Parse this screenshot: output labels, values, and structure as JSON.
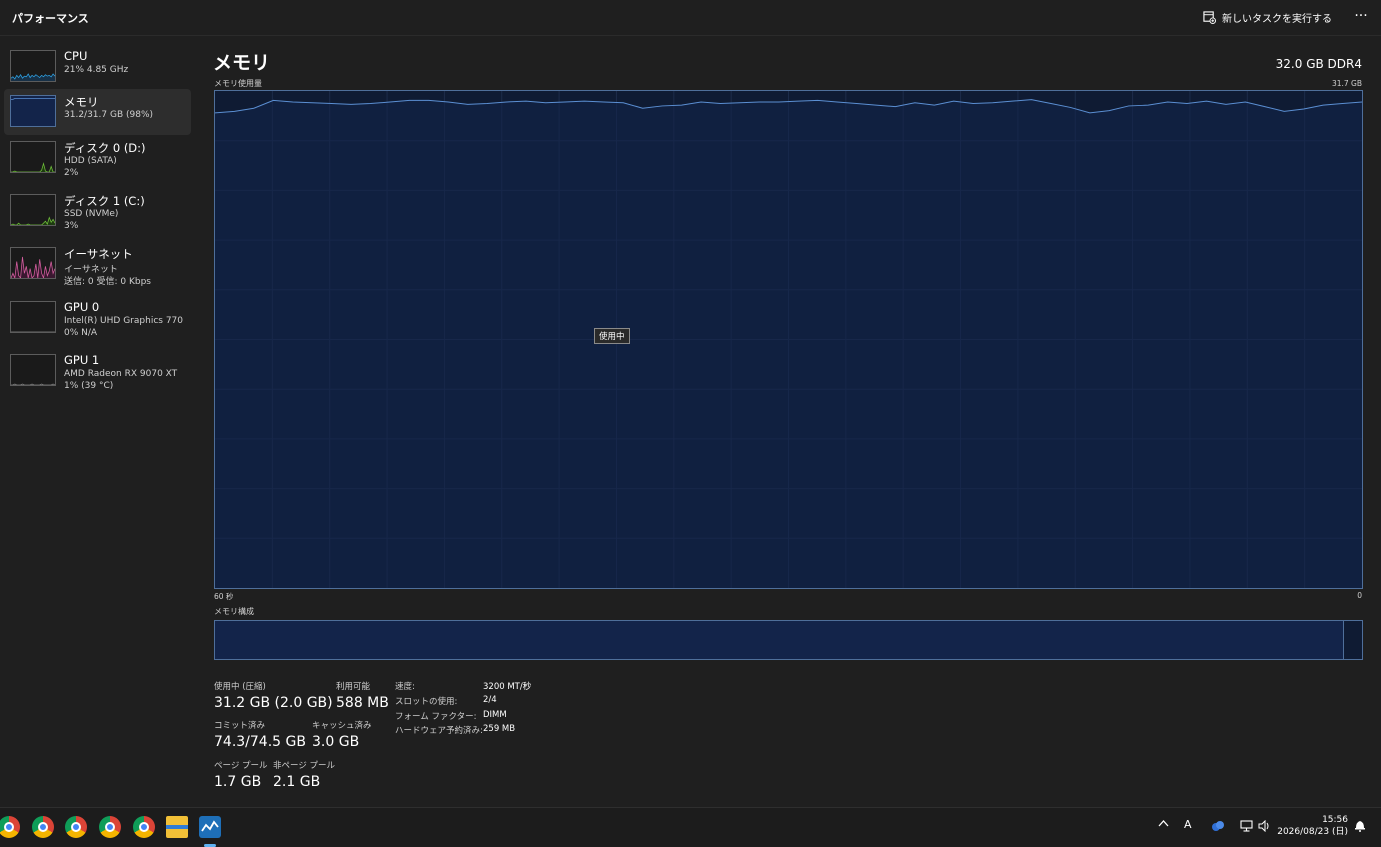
{
  "window": {
    "title": "パフォーマンス",
    "run_task_label": "新しいタスクを実行する",
    "more_label": "···"
  },
  "sidebar": {
    "items": [
      {
        "name": "CPU",
        "sub1": "21% 4.85 GHz",
        "sub2": ""
      },
      {
        "name": "メモリ",
        "sub1": "31.2/31.7 GB (98%)",
        "sub2": ""
      },
      {
        "name": "ディスク 0 (D:)",
        "sub1": "HDD (SATA)",
        "sub2": "2%"
      },
      {
        "name": "ディスク 1 (C:)",
        "sub1": "SSD (NVMe)",
        "sub2": "3%"
      },
      {
        "name": "イーサネット",
        "sub1": "イーサネット",
        "sub2": "送信: 0 受信: 0 Kbps"
      },
      {
        "name": "GPU 0",
        "sub1": "Intel(R) UHD Graphics 770",
        "sub2": "0% N/A"
      },
      {
        "name": "GPU 1",
        "sub1": "AMD Radeon RX 9070 XT",
        "sub2": "1% (39 °C)"
      }
    ]
  },
  "main": {
    "title": "メモリ",
    "spec": "32.0 GB DDR4",
    "graph_label": "メモリ使用量",
    "graph_max": "31.7 GB",
    "tooltip": "使用中",
    "axis_left": "60 秒",
    "axis_right": "0",
    "composition_label": "メモリ構成",
    "composition_used_fraction": 0.984
  },
  "stats": {
    "in_use_label": "使用中 (圧縮)",
    "in_use_value": "31.2 GB (2.0 GB)",
    "available_label": "利用可能",
    "available_value": "588 MB",
    "committed_label": "コミット済み",
    "committed_value": "74.3/74.5 GB",
    "cached_label": "キャッシュ済み",
    "cached_value": "3.0 GB",
    "paged_label": "ページ プール",
    "paged_value": "1.7 GB",
    "nonpaged_label": "非ページ プール",
    "nonpaged_value": "2.1 GB"
  },
  "details": {
    "speed_label": "速度:",
    "speed_value": "3200 MT/秒",
    "slots_label": "スロットの使用:",
    "slots_value": "2/4",
    "form_label": "フォーム ファクター:",
    "form_value": "DIMM",
    "hw_reserved_label": "ハードウェア予約済み:",
    "hw_reserved_value": "259 MB"
  },
  "chart_data": {
    "type": "area",
    "x_range_seconds": [
      60,
      0
    ],
    "ylim_gb": [
      0,
      31.7
    ],
    "series": [
      {
        "values_gb": [
          30.3,
          30.4,
          30.6,
          31.1,
          31.0,
          30.95,
          30.9,
          30.85,
          30.9,
          31.0,
          31.1,
          31.1,
          31.0,
          30.85,
          30.9,
          31.0,
          31.05,
          30.95,
          31.0,
          31.05,
          31.0,
          30.95,
          30.6,
          30.75,
          30.8,
          31.0,
          30.9,
          30.95,
          31.0,
          31.0,
          31.05,
          31.1,
          31.0,
          30.9,
          30.8,
          30.7,
          30.95,
          30.8,
          31.05,
          30.9,
          30.95,
          31.05,
          31.15,
          30.9,
          30.65,
          30.3,
          30.45,
          30.75,
          30.8,
          31.0,
          30.9,
          31.05,
          30.85,
          31.0,
          30.7,
          30.4,
          30.55,
          30.8,
          30.9,
          31.0
        ]
      }
    ],
    "grid": true
  },
  "thumbnails": {
    "cpu": [
      4,
      6,
      3,
      8,
      5,
      9,
      4,
      7,
      6,
      10,
      5,
      8,
      6,
      9,
      7,
      5,
      8,
      6,
      9,
      7,
      8,
      6,
      10,
      7
    ],
    "memory": [
      30,
      30,
      31,
      31,
      31,
      31,
      31,
      31,
      31,
      31,
      31,
      31,
      31,
      31,
      31,
      31,
      31,
      31,
      31,
      31,
      31,
      31,
      31,
      31
    ],
    "disk0": [
      0,
      0,
      1,
      0,
      0,
      0,
      0,
      0,
      0,
      0,
      0,
      0,
      0,
      0,
      0,
      0,
      2,
      9,
      1,
      0,
      0,
      6,
      0,
      0
    ],
    "disk1": [
      0,
      1,
      0,
      0,
      2,
      0,
      0,
      0,
      0,
      1,
      0,
      0,
      0,
      0,
      0,
      0,
      0,
      2,
      4,
      1,
      8,
      3,
      6,
      2
    ],
    "ethernet": [
      0,
      2,
      0,
      7,
      1,
      0,
      9,
      2,
      5,
      0,
      4,
      0,
      1,
      6,
      0,
      8,
      2,
      0,
      5,
      1,
      3,
      7,
      2,
      4
    ],
    "gpu0": [
      0,
      0,
      0,
      0,
      0,
      0,
      0,
      0,
      0,
      0,
      0,
      0,
      0,
      0,
      0,
      0,
      0,
      0,
      0,
      0,
      0,
      0,
      0,
      0
    ],
    "gpu1": [
      0,
      0,
      1,
      0,
      0,
      0,
      1,
      0,
      0,
      0,
      0,
      1,
      0,
      0,
      0,
      0,
      1,
      0,
      0,
      0,
      0,
      0,
      1,
      0
    ]
  },
  "colors": {
    "memory_line": "#5b8fd3",
    "memory_fill": "#0f1b33",
    "cpu_line": "#2ea3e6",
    "disk_line": "#6fbf3a",
    "ethernet_line": "#d55fa0"
  },
  "taskbar": {
    "icons": [
      "chrome-icon",
      "chrome-icon",
      "chrome-icon",
      "chrome-icon",
      "chrome-icon",
      "file-explorer-icon",
      "task-manager-icon"
    ],
    "ime": "A",
    "time": "15:56",
    "date": "2026/08/23 (日)"
  }
}
